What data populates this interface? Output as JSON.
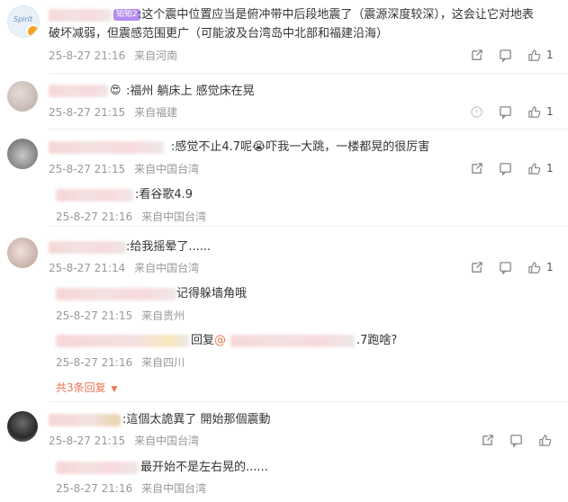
{
  "comments": [
    {
      "badge": "铂铂2",
      "text": ":这个震中位置应当是俯冲带中后段地震了（震源深度较深），这会让它对地表破坏减弱，但震感范围更广（可能波及台湾岛中北部和福建沿海）",
      "line1": ":这个震中位置应当是俯冲带中后段地震了（震源深度较深），这会让它对地表",
      "line2": "破坏减弱，但震感范围更广（可能波及台湾岛中北部和福建沿海）",
      "time": "25-8-27 21:16",
      "source": "来自河南",
      "likes": "1"
    },
    {
      "text": ":福州 躺床上 感觉床在晃",
      "time": "25-8-27 21:15",
      "source": "来自福建",
      "likes": "1"
    },
    {
      "text": ":感觉不止4.7呢😭吓我一大跳，一楼都晃的很厉害",
      "time": "25-8-27 21:15",
      "source": "来自中国台湾",
      "likes": "1",
      "replies": [
        {
          "text": ":看谷歌4.9",
          "time": "25-8-27 21:16",
          "source": "来自中国台湾"
        }
      ]
    },
    {
      "text": ":给我摇晕了......",
      "time": "25-8-27 21:14",
      "source": "来自中国台湾",
      "likes": "1",
      "replies": [
        {
          "text": "记得躲墙角哦",
          "time": "25-8-27 21:15",
          "source": "来自贵州"
        },
        {
          "text_prefix": "回复",
          "text_mention": "@",
          "text_suffix": ".7跑啥?",
          "time": "25-8-27 21:16",
          "source": "来自四川"
        }
      ],
      "more_replies": "共3条回复"
    },
    {
      "text": ":這個太詭異了 開始那個震動",
      "time": "25-8-27 21:15",
      "source": "来自中国台湾",
      "replies": [
        {
          "text": "最开始不是左右晃的......",
          "time": "25-8-27 21:16",
          "source": "来自中国台湾"
        }
      ]
    }
  ],
  "icons": {
    "share": "share-icon",
    "comment": "comment-icon",
    "like": "like-icon",
    "more": "chevron-down-icon"
  },
  "colors": {
    "link": "#eb7350",
    "meta": "#999999",
    "text": "#333333"
  }
}
